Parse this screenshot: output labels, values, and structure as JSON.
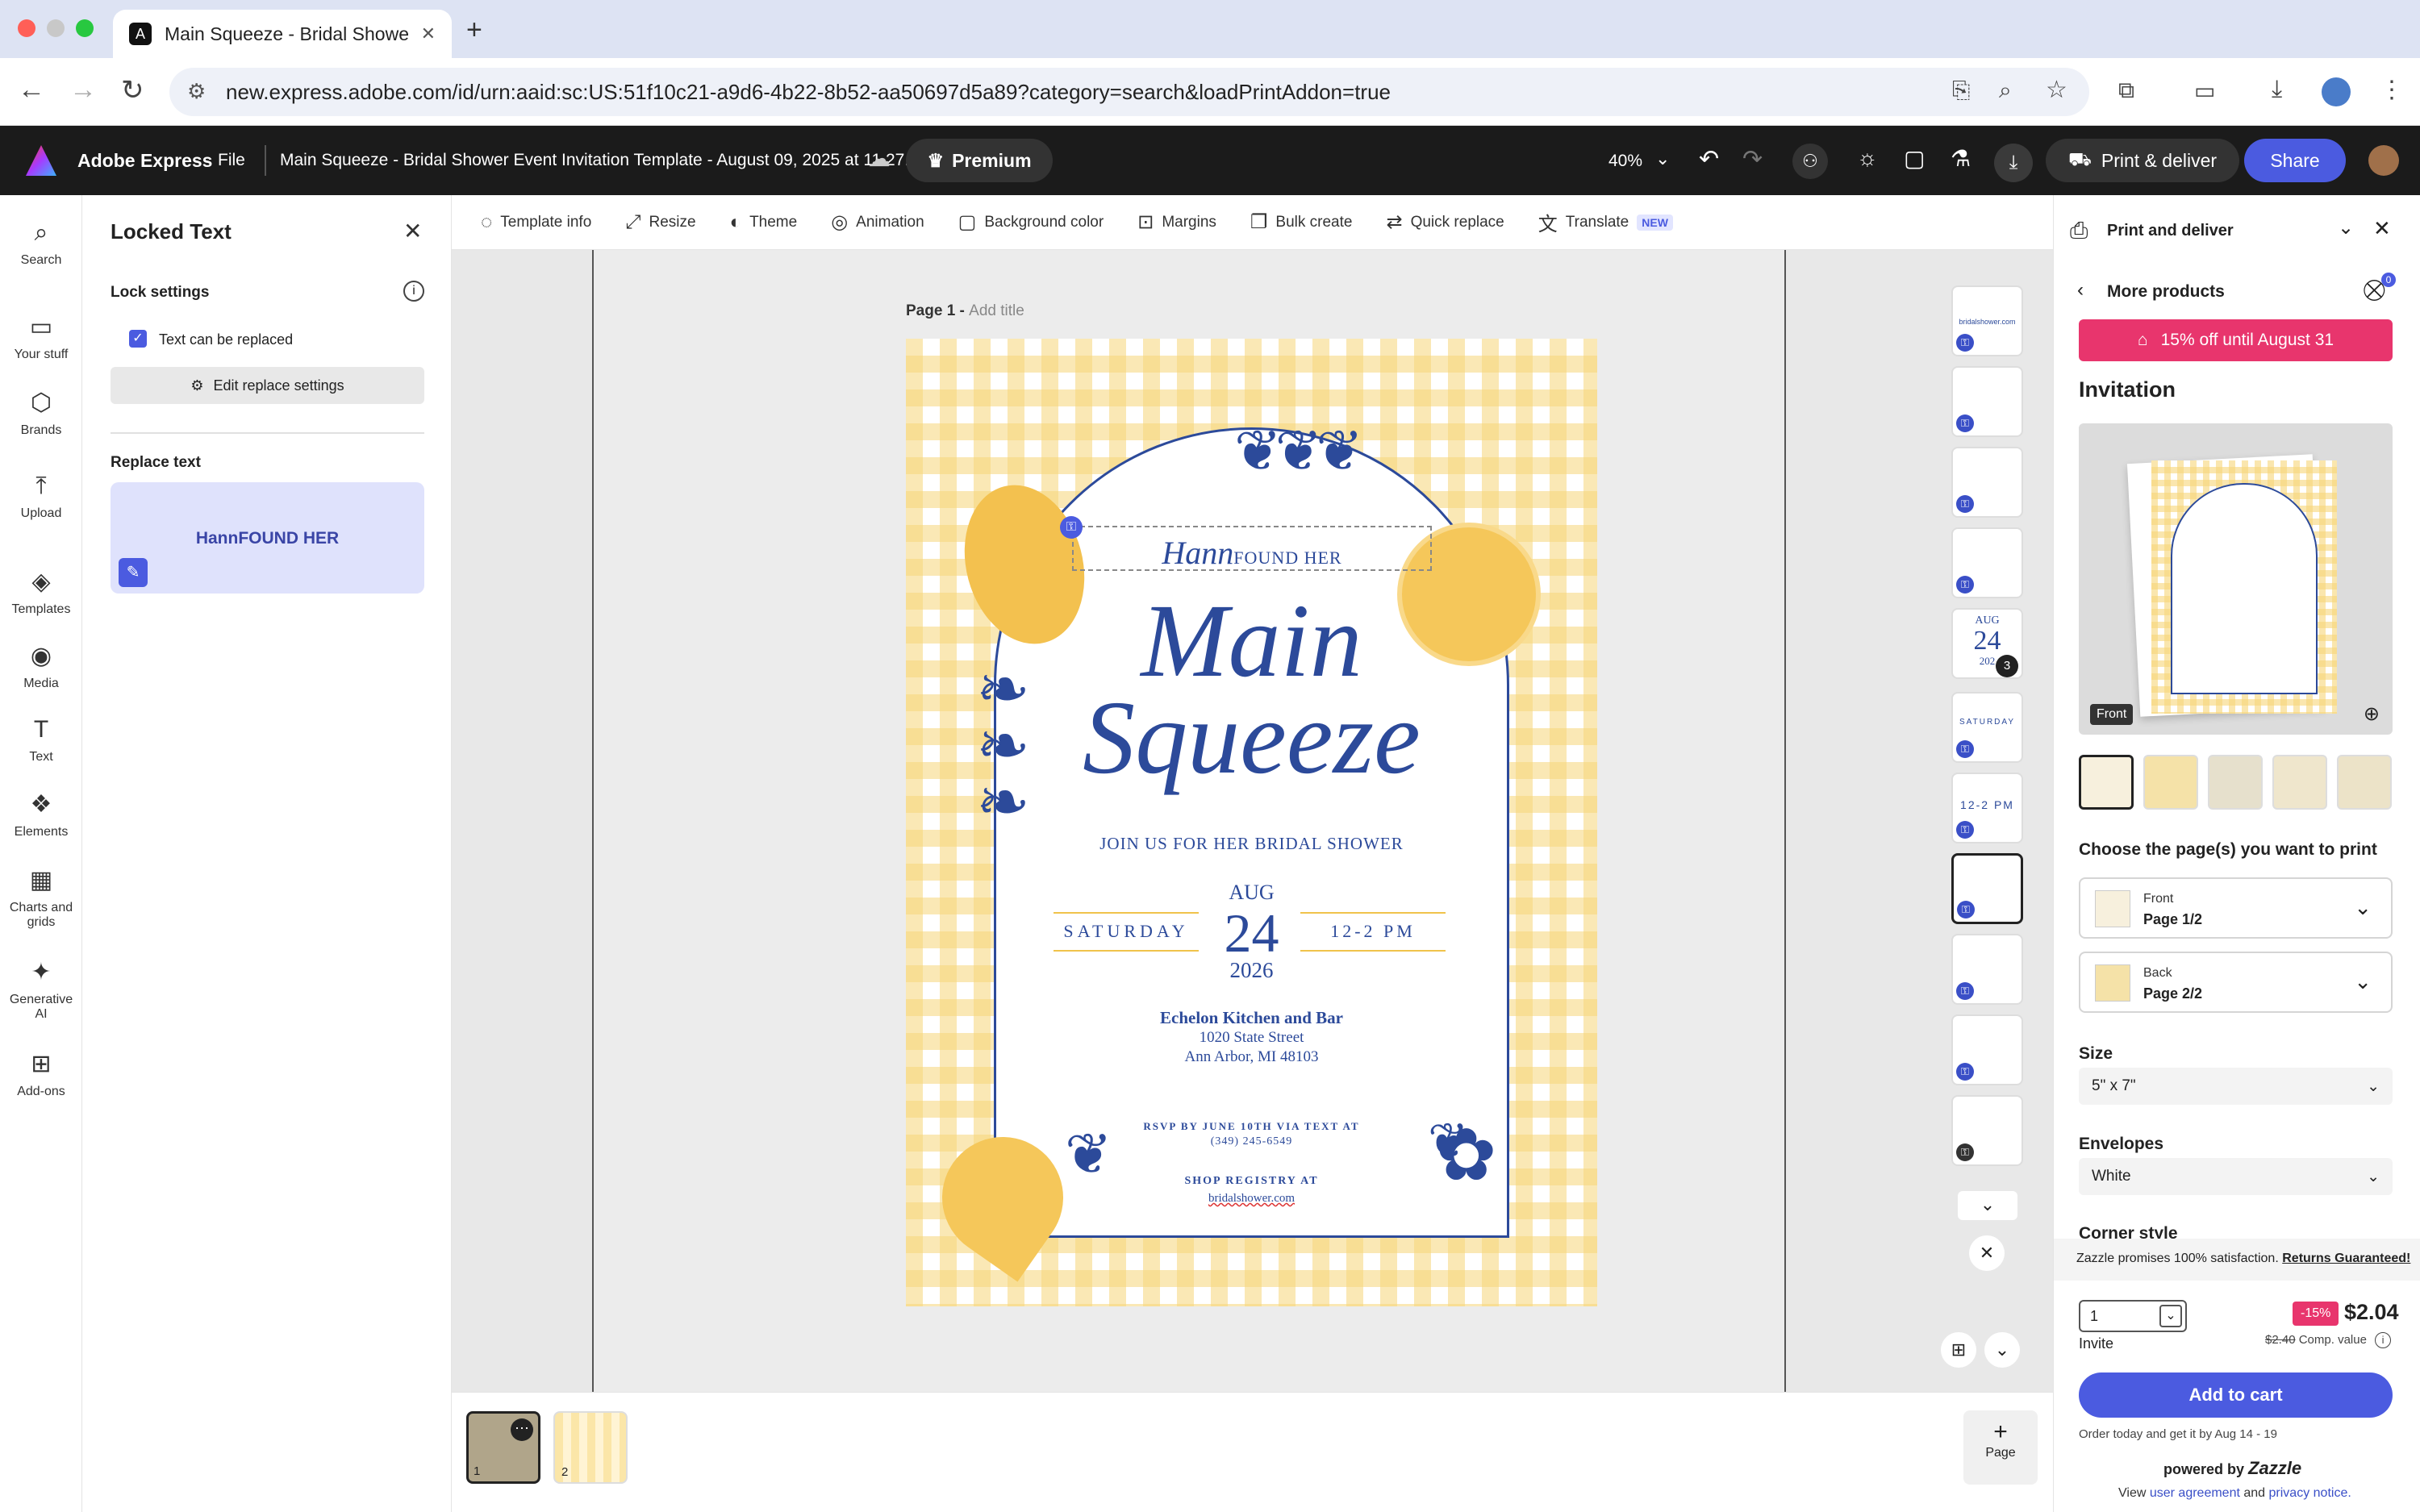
{
  "browser": {
    "tab_title": "Main Squeeze - Bridal Showe",
    "url": "new.express.adobe.com/id/urn:aaid:sc:US:51f10c21-a9d6-4b22-8b52-aa50697d5a89?category=search&loadPrintAddon=true"
  },
  "app": {
    "name": "Adobe Express",
    "file_menu": "File",
    "doc_title": "Main Squeeze - Bridal Shower Event Invitation Template - August 09, 2025 at 11.27.33",
    "premium": "Premium",
    "zoom": "40%",
    "print_deliver": "Print & deliver",
    "share": "Share"
  },
  "rail": [
    {
      "label": "Search",
      "icon": "search-icon"
    },
    {
      "label": "Your stuff",
      "icon": "folder-icon"
    },
    {
      "label": "Brands",
      "icon": "brand-icon"
    },
    {
      "label": "Upload",
      "icon": "upload-icon"
    },
    {
      "label": "Templates",
      "icon": "templates-icon"
    },
    {
      "label": "Media",
      "icon": "media-icon"
    },
    {
      "label": "Text",
      "icon": "text-icon"
    },
    {
      "label": "Elements",
      "icon": "elements-icon"
    },
    {
      "label": "Charts and grids",
      "icon": "charts-icon"
    },
    {
      "label": "Generative AI",
      "icon": "ai-icon"
    },
    {
      "label": "Add-ons",
      "icon": "addons-icon"
    }
  ],
  "lpanel": {
    "title": "Locked Text",
    "lock_settings": "Lock settings",
    "checkbox_label": "Text can be replaced",
    "edit_replace": "Edit replace settings",
    "replace_text": "Replace text",
    "replace_value": "HannFOUND HER"
  },
  "toolbar": [
    "Template info",
    "Resize",
    "Theme",
    "Animation",
    "Background color",
    "Margins",
    "Bulk create",
    "Quick replace",
    "Translate"
  ],
  "toolbar_new_badge": "NEW",
  "page": {
    "label": "Page 1 -",
    "add_title": "Add title"
  },
  "card": {
    "name_script": "Hann",
    "name_caps": "FOUND HER",
    "title_line1": "Main",
    "title_line2": "Squeeze",
    "join": "JOIN US FOR HER BRIDAL SHOWER",
    "day": "SATURDAY",
    "month": "AUG",
    "date": "24",
    "year": "2026",
    "time": "12-2 PM",
    "venue": "Echelon Kitchen and Bar",
    "street": "1020 State Street",
    "city": "Ann Arbor, MI 48103",
    "rsvp": "RSVP BY JUNE 10TH VIA TEXT AT",
    "phone": "(349) 245-6549",
    "registry": "SHOP REGISTRY AT",
    "registry_url": "bridalshower.com"
  },
  "thumbs": {
    "aug": "AUG",
    "date": "24",
    "year_partial": "202",
    "badge": "3",
    "saturday": "SATURDAY",
    "time": "12-2 PM",
    "site": "bridalshower.com"
  },
  "pages_strip": {
    "p1": "1",
    "p2": "2",
    "add_page": "Page"
  },
  "rpanel": {
    "title": "Print and deliver",
    "more_products": "More products",
    "cart_count": "0",
    "promo": "15% off until August 31",
    "product": "Invitation",
    "preview_tag": "Front",
    "choose_pages": "Choose the page(s) you want to print",
    "front_label": "Front",
    "front_page": "Page 1/2",
    "back_label": "Back",
    "back_page": "Page 2/2",
    "size_label": "Size",
    "size_value": "5\" x 7\"",
    "envelopes_label": "Envelopes",
    "envelopes_value": "White",
    "corner_label": "Corner style",
    "zazzle_promise": "Zazzle promises 100% satisfaction.",
    "returns": "Returns Guaranteed!",
    "qty": "1",
    "qty_unit": "Invite",
    "discount": "-15%",
    "price": "$2.04",
    "old_price": "$2.40",
    "comp": "Comp. value",
    "add_cart": "Add to cart",
    "delivery": "Order today and get it by Aug 14 - 19",
    "powered": "powered by",
    "zazzle": "Zazzle",
    "view": "View",
    "user_agreement": "user agreement",
    "and": "and",
    "privacy": "privacy notice."
  },
  "colors": {
    "accent": "#4b5be0",
    "promo": "#e8356d",
    "card_blue": "#2c4a9a",
    "gingham": "#f6d678"
  }
}
